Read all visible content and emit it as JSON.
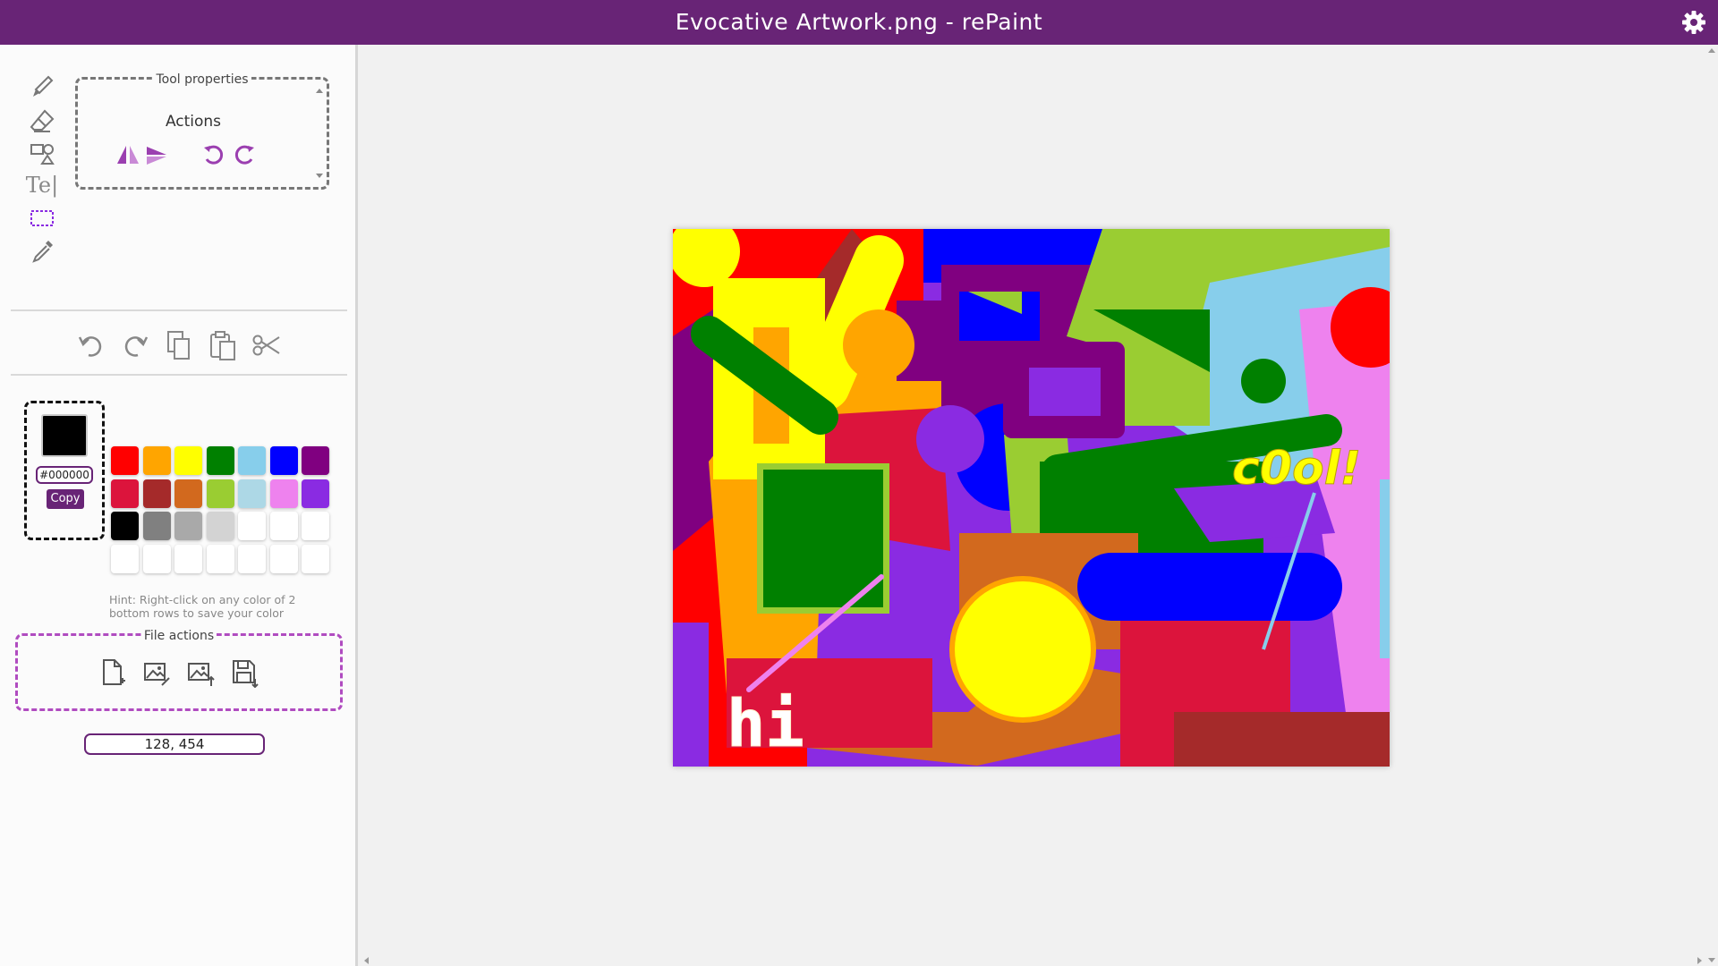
{
  "window": {
    "title": "Evocative Artwork.png - rePaint"
  },
  "tool_properties": {
    "legend": "Tool properties",
    "actions_label": "Actions"
  },
  "tools": {
    "text_glyph": "Te|"
  },
  "icons": {
    "settings": "gear-icon",
    "brush": "brush-icon",
    "eraser": "eraser-icon",
    "shapes": "shapes-icon",
    "text": "text-tool-icon",
    "select": "rect-select-icon",
    "picker": "color-picker-icon",
    "flip_h": "flip-horizontal-icon",
    "flip_v": "flip-vertical-icon",
    "rot_ccw": "rotate-left-icon",
    "rot_cw": "rotate-right-icon",
    "undo": "undo-icon",
    "redo": "redo-icon",
    "copy": "copy-icon",
    "paste": "paste-icon",
    "cut": "scissors-icon",
    "new_file": "new-file-icon",
    "edit_image": "edit-image-icon",
    "upload_image": "upload-image-icon",
    "save": "save-icon"
  },
  "current_color": {
    "hex": "#000000",
    "copy_label": "Copy"
  },
  "palette": [
    [
      "#ff0000",
      "#ffa500",
      "#ffff00",
      "#008000",
      "#87ceeb",
      "#0000ff",
      "#800080"
    ],
    [
      "#dc143c",
      "#a52a2a",
      "#d2691e",
      "#9acd32",
      "#add8e6",
      "#ee82ee",
      "#8a2be2"
    ],
    [
      "#000000",
      "#808080",
      "#a9a9a9",
      "#d3d3d3",
      "#ffffff",
      "#ffffff",
      "#ffffff"
    ],
    [
      "#ffffff",
      "#ffffff",
      "#ffffff",
      "#ffffff",
      "#ffffff",
      "#ffffff",
      "#ffffff"
    ]
  ],
  "hint": "Hint: Right-click on any color of 2 bottom rows to save your color",
  "file_actions": {
    "legend": "File actions"
  },
  "coordinates": "128, 454",
  "artwork": {
    "text_hi": "hi",
    "text_cool": "c0ol!"
  },
  "colors": {
    "accent": "#682476",
    "dashed_border": "#b04cc0"
  }
}
